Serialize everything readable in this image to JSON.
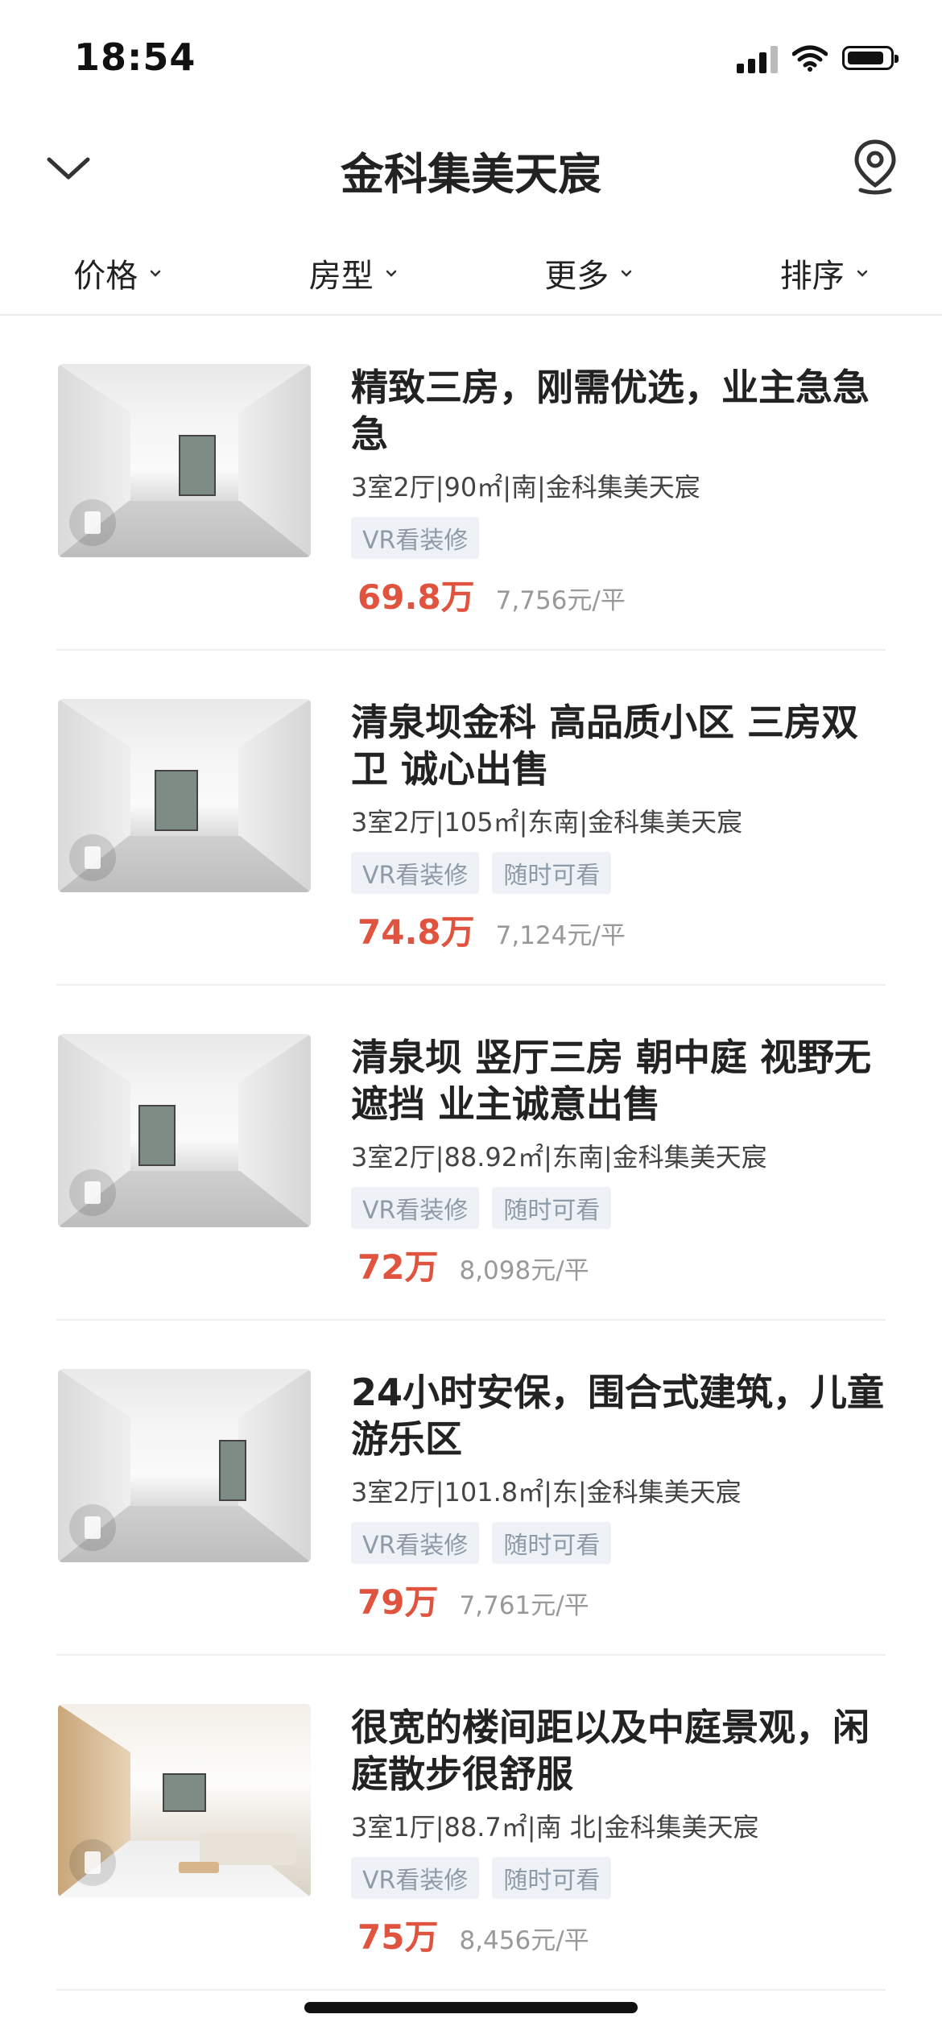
{
  "status_bar": {
    "time": "18:54"
  },
  "header": {
    "title": "金科集美天宸"
  },
  "filters": [
    {
      "label": "价格"
    },
    {
      "label": "房型"
    },
    {
      "label": "更多"
    },
    {
      "label": "排序"
    }
  ],
  "listings": [
    {
      "title": "精致三房，刚需优选，业主急急急",
      "meta": "3室2厅|90㎡|南|金科集美天宸",
      "tags": [
        "VR看装修"
      ],
      "price": "69.8万",
      "unit_price": "7,756元/平"
    },
    {
      "title": "清泉坝金科 高品质小区 三房双卫 诚心出售",
      "meta": "3室2厅|105㎡|东南|金科集美天宸",
      "tags": [
        "VR看装修",
        "随时可看"
      ],
      "price": "74.8万",
      "unit_price": "7,124元/平"
    },
    {
      "title": "清泉坝 竖厅三房 朝中庭 视野无遮挡 业主诚意出售",
      "meta": "3室2厅|88.92㎡|东南|金科集美天宸",
      "tags": [
        "VR看装修",
        "随时可看"
      ],
      "price": "72万",
      "unit_price": "8,098元/平"
    },
    {
      "title": "24小时安保，围合式建筑，儿童游乐区",
      "meta": "3室2厅|101.8㎡|东|金科集美天宸",
      "tags": [
        "VR看装修",
        "随时可看"
      ],
      "price": "79万",
      "unit_price": "7,761元/平"
    },
    {
      "title": "很宽的楼间距以及中庭景观，闲庭散步很舒服",
      "meta": "3室1厅|88.7㎡|南 北|金科集美天宸",
      "tags": [
        "VR看装修",
        "随时可看"
      ],
      "price": "75万",
      "unit_price": "8,456元/平"
    }
  ],
  "colors": {
    "price": "#e0533f",
    "tag_bg": "#eef1f5",
    "tag_text": "#8d9aa8"
  },
  "icons": {
    "back": "chevron-down-icon",
    "location": "location-pin-icon",
    "filter_caret": "caret-down-icon"
  }
}
